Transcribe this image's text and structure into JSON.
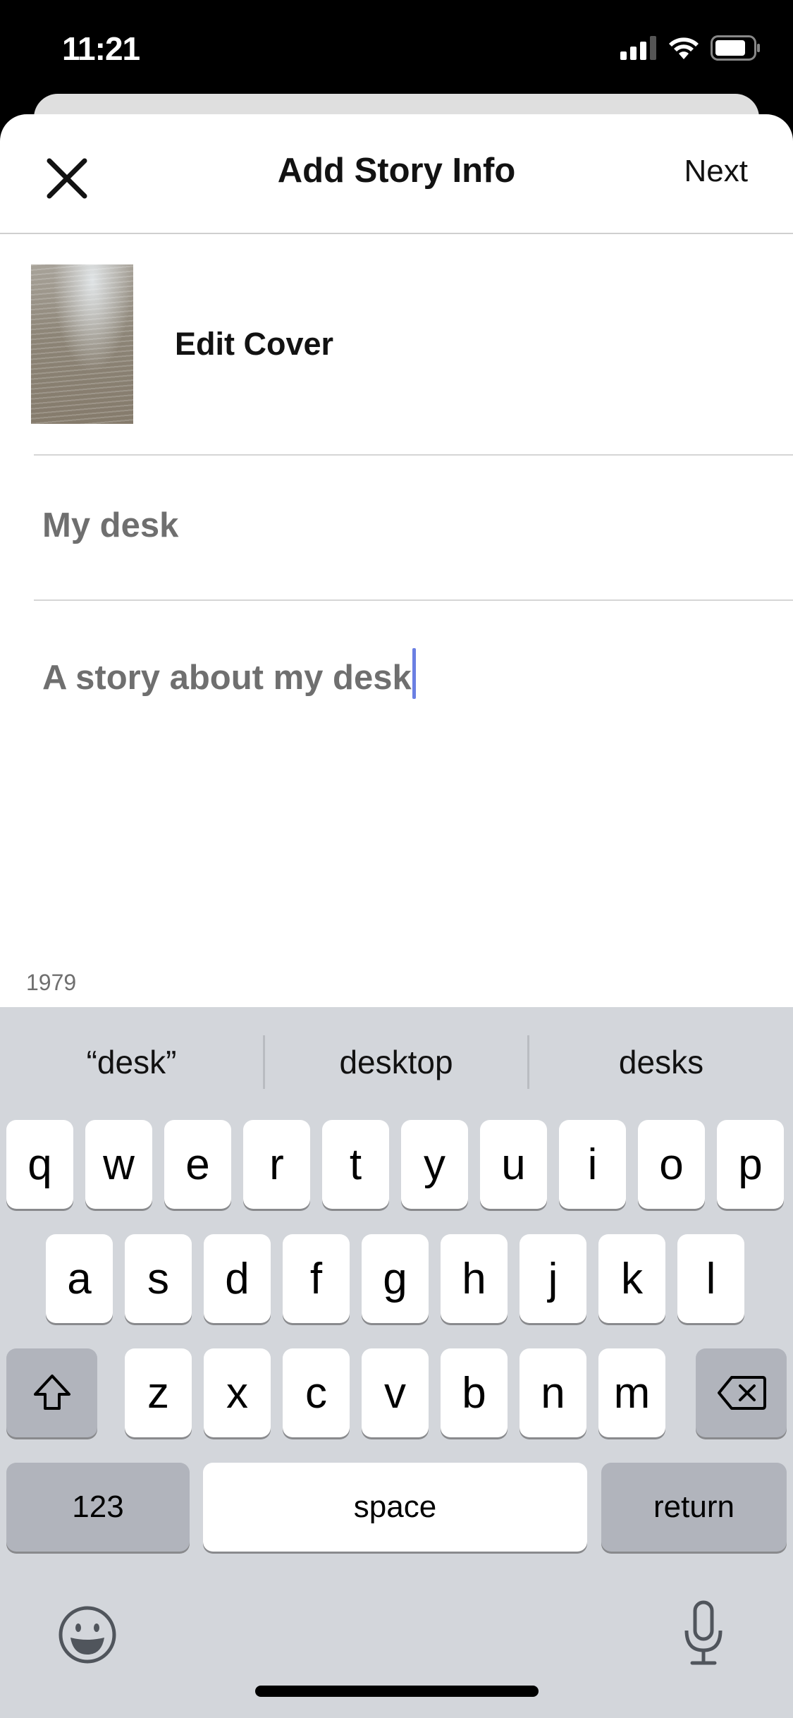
{
  "status_bar": {
    "time": "11:21",
    "icons": [
      "cellular-signal-icon",
      "wifi-icon",
      "battery-icon"
    ]
  },
  "header": {
    "close_icon": "close-icon",
    "title": "Add Story Info",
    "next_label": "Next"
  },
  "cover": {
    "label": "Edit Cover"
  },
  "form": {
    "title_value": "My desk",
    "description_value": "A story about my desk",
    "char_count": "1979"
  },
  "keyboard": {
    "suggestions": [
      "“desk”",
      "desktop",
      "desks"
    ],
    "row1": [
      "q",
      "w",
      "e",
      "r",
      "t",
      "y",
      "u",
      "i",
      "o",
      "p"
    ],
    "row2": [
      "a",
      "s",
      "d",
      "f",
      "g",
      "h",
      "j",
      "k",
      "l"
    ],
    "row3": [
      "z",
      "x",
      "c",
      "v",
      "b",
      "n",
      "m"
    ],
    "numbers_label": "123",
    "space_label": "space",
    "return_label": "return",
    "shift_icon": "shift-icon",
    "delete_icon": "delete-icon",
    "emoji_icon": "emoji-icon",
    "mic_icon": "microphone-icon"
  },
  "colors": {
    "caret": "#6b7fe3",
    "keyboard_bg": "#d3d6db",
    "field_text": "#6f6f6f"
  }
}
